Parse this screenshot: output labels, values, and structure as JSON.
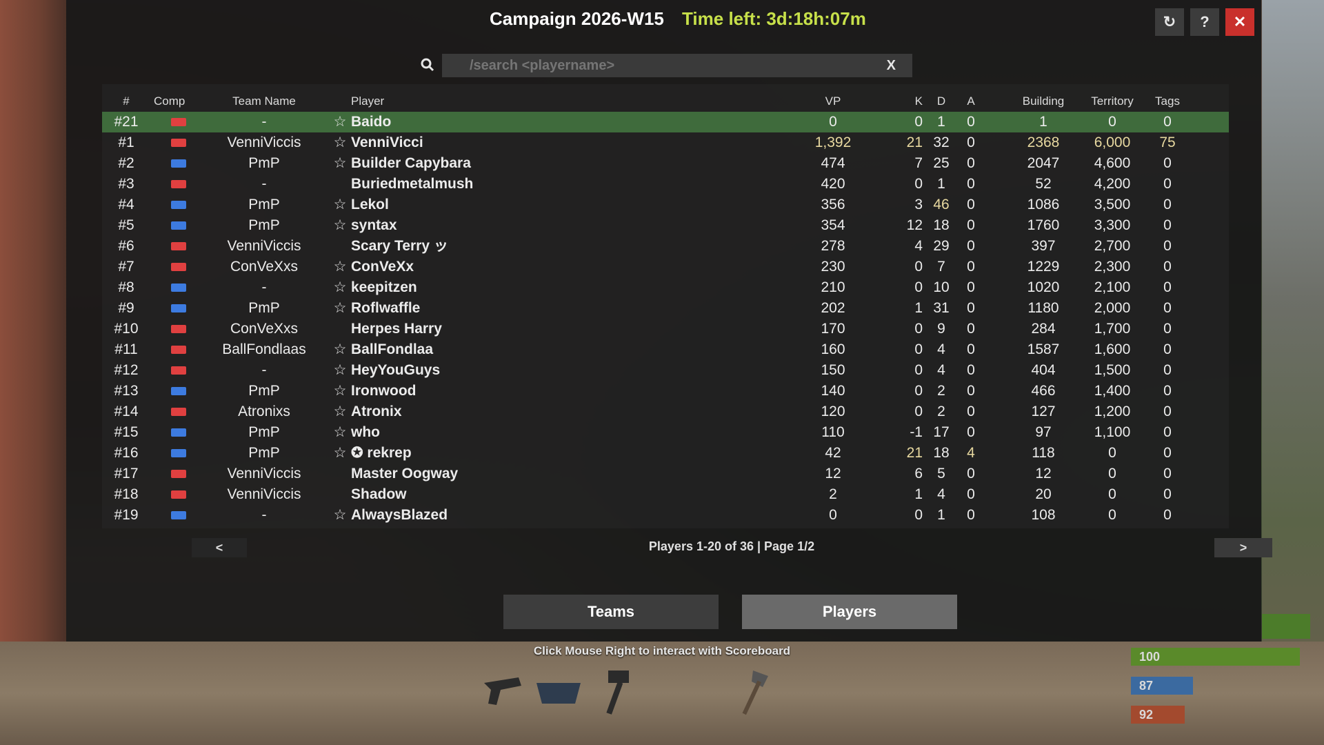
{
  "header": {
    "title": "Campaign 2026-W15",
    "time_left": "Time left: 3d:18h:07m",
    "buttons": {
      "refresh": "↻",
      "help": "?",
      "close": "✕"
    }
  },
  "search": {
    "placeholder": "/search <playername>",
    "value": "",
    "clear_label": "X"
  },
  "columns": [
    "#",
    "Comp",
    "Team Name",
    "Player",
    "VP",
    "K",
    "D",
    "A",
    "Building",
    "Territory",
    "Tags"
  ],
  "colors": {
    "red_team": "#e04040",
    "blue_team": "#3d7be0",
    "highlight_row": "#3f6b3c",
    "time_left": "#c7e04a"
  },
  "rows": [
    {
      "rank": "#21",
      "comp": "red",
      "team": "-",
      "star": true,
      "player": "Baido",
      "vp": "0",
      "k": "0",
      "d": "1",
      "a": "0",
      "building": "1",
      "territory": "0",
      "tags": "0",
      "highlight": true
    },
    {
      "rank": "#1",
      "comp": "red",
      "team": "VenniViccis",
      "star": true,
      "player": "VenniVicci",
      "vp": "1,392",
      "k": "21",
      "d": "32",
      "a": "0",
      "building": "2368",
      "territory": "6,000",
      "tags": "75",
      "hi": [
        "vp",
        "k",
        "building",
        "territory",
        "tags"
      ]
    },
    {
      "rank": "#2",
      "comp": "blue",
      "team": "PmP",
      "star": true,
      "player": "Builder Capybara",
      "vp": "474",
      "k": "7",
      "d": "25",
      "a": "0",
      "building": "2047",
      "territory": "4,600",
      "tags": "0"
    },
    {
      "rank": "#3",
      "comp": "red",
      "team": "-",
      "star": false,
      "player": "Buriedmetalmush",
      "vp": "420",
      "k": "0",
      "d": "1",
      "a": "0",
      "building": "52",
      "territory": "4,200",
      "tags": "0"
    },
    {
      "rank": "#4",
      "comp": "blue",
      "team": "PmP",
      "star": true,
      "player": "Lekol",
      "vp": "356",
      "k": "3",
      "d": "46",
      "a": "0",
      "building": "1086",
      "territory": "3,500",
      "tags": "0",
      "hi": [
        "d"
      ]
    },
    {
      "rank": "#5",
      "comp": "blue",
      "team": "PmP",
      "star": true,
      "player": "syntax",
      "vp": "354",
      "k": "12",
      "d": "18",
      "a": "0",
      "building": "1760",
      "territory": "3,300",
      "tags": "0"
    },
    {
      "rank": "#6",
      "comp": "red",
      "team": "VenniViccis",
      "star": false,
      "player": "Scary Terry ッ",
      "vp": "278",
      "k": "4",
      "d": "29",
      "a": "0",
      "building": "397",
      "territory": "2,700",
      "tags": "0"
    },
    {
      "rank": "#7",
      "comp": "red",
      "team": "ConVeXxs",
      "star": true,
      "player": "ConVeXx",
      "vp": "230",
      "k": "0",
      "d": "7",
      "a": "0",
      "building": "1229",
      "territory": "2,300",
      "tags": "0"
    },
    {
      "rank": "#8",
      "comp": "blue",
      "team": "-",
      "star": true,
      "player": "keepitzen",
      "vp": "210",
      "k": "0",
      "d": "10",
      "a": "0",
      "building": "1020",
      "territory": "2,100",
      "tags": "0"
    },
    {
      "rank": "#9",
      "comp": "blue",
      "team": "PmP",
      "star": true,
      "player": "Roflwaffle",
      "vp": "202",
      "k": "1",
      "d": "31",
      "a": "0",
      "building": "1180",
      "territory": "2,000",
      "tags": "0"
    },
    {
      "rank": "#10",
      "comp": "red",
      "team": "ConVeXxs",
      "star": false,
      "player": "Herpes Harry",
      "vp": "170",
      "k": "0",
      "d": "9",
      "a": "0",
      "building": "284",
      "territory": "1,700",
      "tags": "0"
    },
    {
      "rank": "#11",
      "comp": "red",
      "team": "BallFondlaas",
      "star": true,
      "player": "BallFondlaa",
      "vp": "160",
      "k": "0",
      "d": "4",
      "a": "0",
      "building": "1587",
      "territory": "1,600",
      "tags": "0"
    },
    {
      "rank": "#12",
      "comp": "red",
      "team": "-",
      "star": true,
      "player": "HeyYouGuys",
      "vp": "150",
      "k": "0",
      "d": "4",
      "a": "0",
      "building": "404",
      "territory": "1,500",
      "tags": "0"
    },
    {
      "rank": "#13",
      "comp": "blue",
      "team": "PmP",
      "star": true,
      "player": "Ironwood",
      "vp": "140",
      "k": "0",
      "d": "2",
      "a": "0",
      "building": "466",
      "territory": "1,400",
      "tags": "0"
    },
    {
      "rank": "#14",
      "comp": "red",
      "team": "Atronixs",
      "star": true,
      "player": "Atronix",
      "vp": "120",
      "k": "0",
      "d": "2",
      "a": "0",
      "building": "127",
      "territory": "1,200",
      "tags": "0"
    },
    {
      "rank": "#15",
      "comp": "blue",
      "team": "PmP",
      "star": true,
      "player": "who",
      "vp": "110",
      "k": "-1",
      "d": "17",
      "a": "0",
      "building": "97",
      "territory": "1,100",
      "tags": "0"
    },
    {
      "rank": "#16",
      "comp": "blue",
      "team": "PmP",
      "star": true,
      "player": "✪ rekrep",
      "vp": "42",
      "k": "21",
      "d": "18",
      "a": "4",
      "building": "118",
      "territory": "0",
      "tags": "0",
      "hi": [
        "k",
        "a"
      ]
    },
    {
      "rank": "#17",
      "comp": "red",
      "team": "VenniViccis",
      "star": false,
      "player": "Master Oogway",
      "vp": "12",
      "k": "6",
      "d": "5",
      "a": "0",
      "building": "12",
      "territory": "0",
      "tags": "0"
    },
    {
      "rank": "#18",
      "comp": "red",
      "team": "VenniViccis",
      "star": false,
      "player": "Shadow",
      "vp": "2",
      "k": "1",
      "d": "4",
      "a": "0",
      "building": "20",
      "territory": "0",
      "tags": "0"
    },
    {
      "rank": "#19",
      "comp": "blue",
      "team": "-",
      "star": true,
      "player": "AlwaysBlazed",
      "vp": "0",
      "k": "0",
      "d": "1",
      "a": "0",
      "building": "108",
      "territory": "0",
      "tags": "0"
    }
  ],
  "pager": {
    "prev": "<",
    "next": ">",
    "info": "Players 1-20 of 36  |  Page 1/2"
  },
  "tabs": {
    "teams": "Teams",
    "players": "Players"
  },
  "hint": "Click Mouse Right to interact with Scoreboard",
  "status_bars": {
    "health": "100",
    "water": "87",
    "food": "92"
  }
}
